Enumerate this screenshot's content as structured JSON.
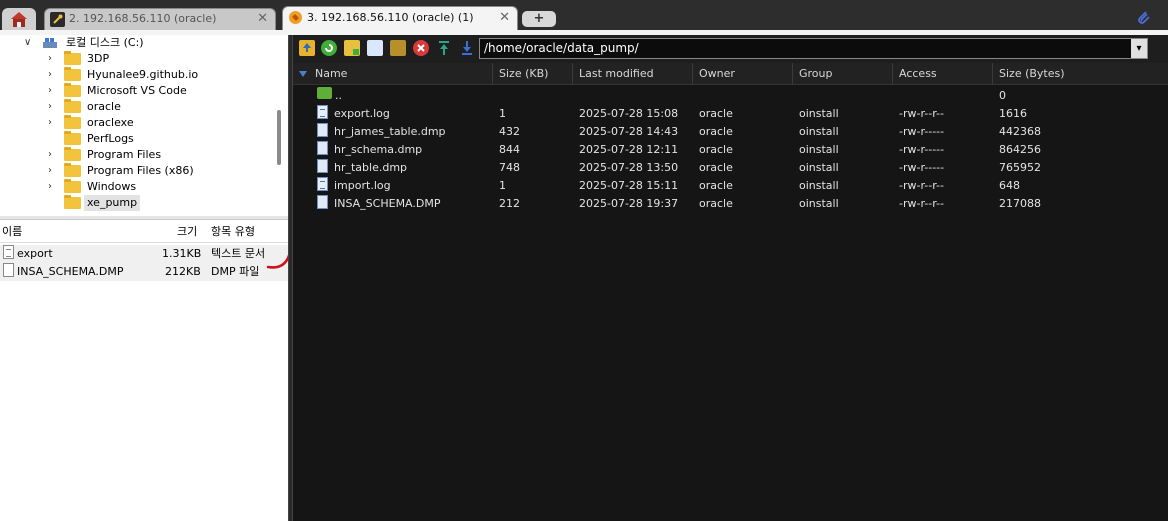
{
  "tabs": {
    "tab2_label": "2. 192.168.56.110 (oracle)",
    "tab3_label": "3. 192.168.56.110 (oracle) (1)",
    "close_glyph": "✕",
    "add_glyph": "+"
  },
  "tree": {
    "drive_label": "로컬 디스크 (C:)",
    "folders": [
      "3DP",
      "Hyunalee9.github.io",
      "Microsoft VS Code",
      "oracle",
      "oraclexe",
      "PerfLogs",
      "Program Files",
      "Program Files (x86)",
      "Windows",
      "xe_pump"
    ]
  },
  "local_files": {
    "headers": {
      "name": "이름",
      "size": "크기",
      "type": "항목 유형"
    },
    "rows": [
      {
        "name": "export",
        "size": "1.31KB",
        "type": "텍스트 문서"
      },
      {
        "name": "INSA_SCHEMA.DMP",
        "size": "212KB",
        "type": "DMP 파일"
      }
    ]
  },
  "remote": {
    "path": "/home/oracle/data_pump/",
    "headers": {
      "name": "Name",
      "size_kb": "Size (KB)",
      "modified": "Last modified",
      "owner": "Owner",
      "group": "Group",
      "access": "Access",
      "size_bytes": "Size (Bytes)"
    },
    "rows": [
      {
        "name": "..",
        "size_kb": "",
        "modified": "",
        "owner": "",
        "group": "",
        "access": "",
        "size_bytes": "0",
        "icon": "parent-dir-icon"
      },
      {
        "name": "export.log",
        "size_kb": "1",
        "modified": "2025-07-28 15:08",
        "owner": "oracle",
        "group": "oinstall",
        "access": "-rw-r--r--",
        "size_bytes": "1616",
        "icon": "log-file-icon"
      },
      {
        "name": "hr_james_table.dmp",
        "size_kb": "432",
        "modified": "2025-07-28 14:43",
        "owner": "oracle",
        "group": "oinstall",
        "access": "-rw-r-----",
        "size_bytes": "442368",
        "icon": "file-icon"
      },
      {
        "name": "hr_schema.dmp",
        "size_kb": "844",
        "modified": "2025-07-28 12:11",
        "owner": "oracle",
        "group": "oinstall",
        "access": "-rw-r-----",
        "size_bytes": "864256",
        "icon": "file-icon"
      },
      {
        "name": "hr_table.dmp",
        "size_kb": "748",
        "modified": "2025-07-28 13:50",
        "owner": "oracle",
        "group": "oinstall",
        "access": "-rw-r-----",
        "size_bytes": "765952",
        "icon": "file-icon"
      },
      {
        "name": "import.log",
        "size_kb": "1",
        "modified": "2025-07-28 15:11",
        "owner": "oracle",
        "group": "oinstall",
        "access": "-rw-r--r--",
        "size_bytes": "648",
        "icon": "log-file-icon"
      },
      {
        "name": "INSA_SCHEMA.DMP",
        "size_kb": "212",
        "modified": "2025-07-28 19:37",
        "owner": "oracle",
        "group": "oinstall",
        "access": "-rw-r--r--",
        "size_bytes": "217088",
        "icon": "file-icon"
      }
    ]
  },
  "colors": {
    "accent_blue": "#4a7fd0",
    "folder": "#f3c33c",
    "annotation_red": "#d0101a",
    "pane_dark": "#151515"
  }
}
